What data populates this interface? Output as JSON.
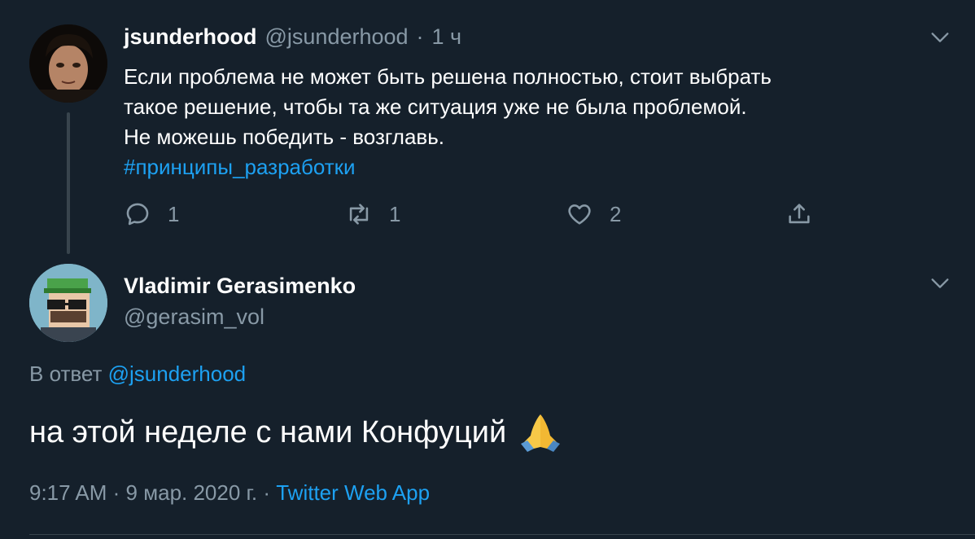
{
  "parent_tweet": {
    "author_name": "jsunderhood",
    "author_handle": "@jsunderhood",
    "separator": "·",
    "time_ago": "1 ч",
    "text_lines": [
      "Если проблема не может быть решена полностью, стоит выбрать",
      "такое решение, чтобы та же ситуация уже не была проблемой.",
      "Не можешь победить - возглавь."
    ],
    "hashtag": "#принципы_разработки",
    "actions": {
      "reply_count": "1",
      "retweet_count": "1",
      "like_count": "2"
    },
    "icons": {
      "reply": "reply-icon",
      "retweet": "retweet-icon",
      "like": "heart-icon",
      "share": "share-icon",
      "menu": "chevron-down-icon"
    }
  },
  "reply_tweet": {
    "author_name": "Vladimir Gerasimenko",
    "author_handle": "@gerasim_vol",
    "reply_prefix": "В ответ",
    "reply_to_handle": "@jsunderhood",
    "text": "на этой неделе с нами Конфуций",
    "emoji": "folded-hands-emoji",
    "time": "9:17 AM",
    "separator": "·",
    "date": "9 мар. 2020 г.",
    "source_separator": "·",
    "source": "Twitter Web App"
  },
  "colors": {
    "background": "#15202b",
    "primary_text": "#ffffff",
    "secondary_text": "#8899a6",
    "accent": "#1da1f2",
    "border": "#38444d"
  }
}
